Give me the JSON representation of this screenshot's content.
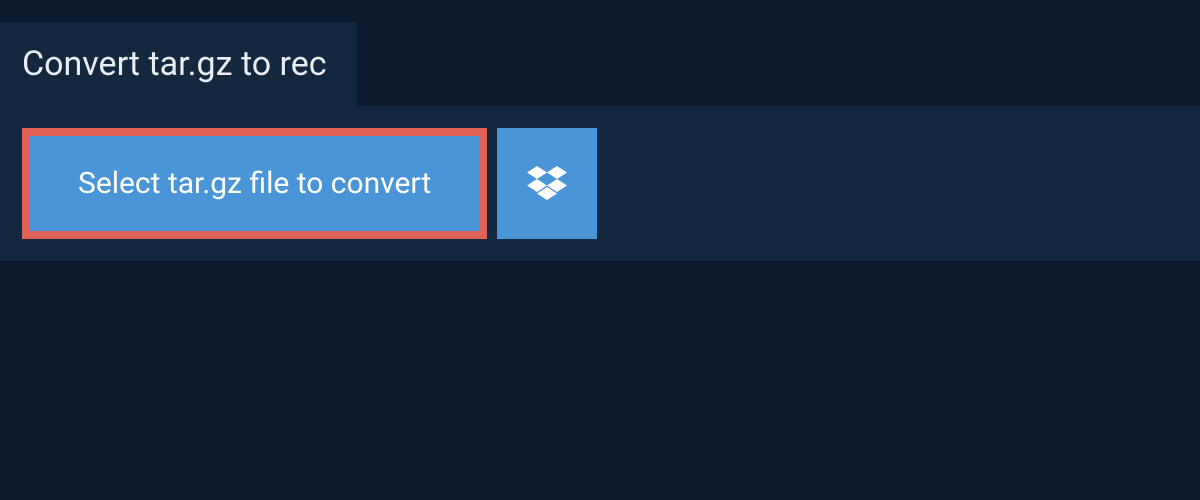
{
  "header": {
    "title": "Convert tar.gz to rec"
  },
  "upload": {
    "select_button_label": "Select tar.gz file to convert"
  },
  "colors": {
    "background": "#0a1b2e",
    "panel": "#13283f",
    "button": "#4a95d7",
    "button_border": "#e06156",
    "text_light": "#e8eef4",
    "text_white": "#ffffff"
  }
}
